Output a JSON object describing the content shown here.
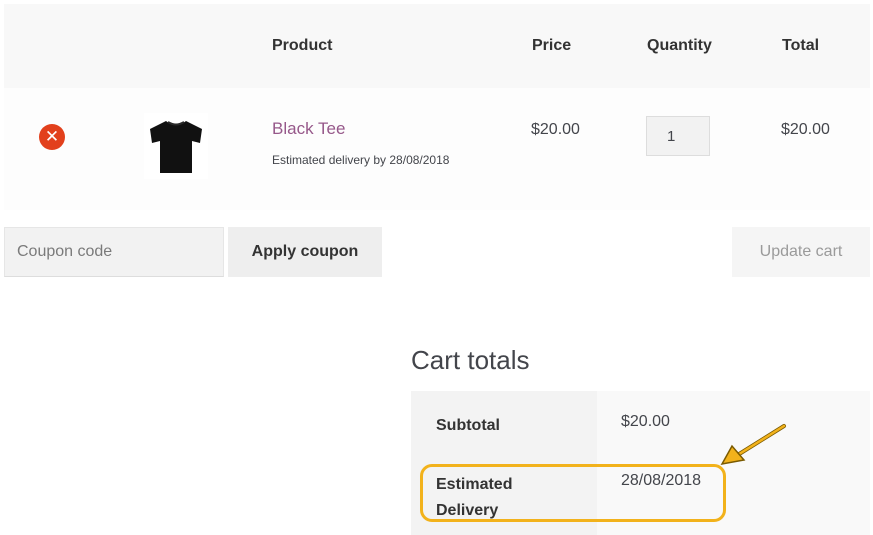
{
  "cart_table": {
    "headers": {
      "product": "Product",
      "price": "Price",
      "quantity": "Quantity",
      "total": "Total"
    },
    "items": [
      {
        "remove_icon": "remove-icon",
        "thumbnail_icon": "tshirt-icon",
        "name": "Black Tee",
        "delivery_note": "Estimated delivery by 28/08/2018",
        "price": "$20.00",
        "quantity": "1",
        "total": "$20.00"
      }
    ]
  },
  "actions": {
    "coupon_placeholder": "Coupon code",
    "apply_label": "Apply coupon",
    "update_label": "Update cart"
  },
  "cart_totals": {
    "title": "Cart totals",
    "rows": [
      {
        "label": "Subtotal",
        "value": "$20.00"
      },
      {
        "label": "Estimated Delivery",
        "value": "28/08/2018"
      }
    ]
  },
  "colors": {
    "link": "#96588a",
    "remove": "#e2401c",
    "highlight": "#f2b21b"
  }
}
